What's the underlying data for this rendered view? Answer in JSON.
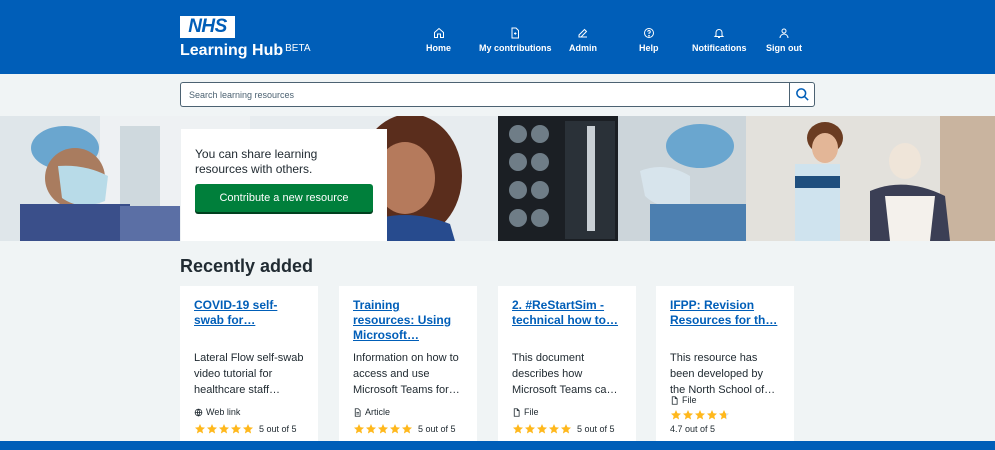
{
  "header": {
    "logo_text": "NHS",
    "app_name": "Learning Hub",
    "app_badge": "BETA",
    "nav": [
      {
        "label": "Home",
        "icon": "home-icon"
      },
      {
        "label": "My contributions",
        "icon": "document-icon"
      },
      {
        "label": "Admin",
        "icon": "edit-icon"
      },
      {
        "label": "Help",
        "icon": "help-icon"
      },
      {
        "label": "Notifications",
        "icon": "bell-icon"
      },
      {
        "label": "Sign out",
        "icon": "user-icon"
      }
    ]
  },
  "search": {
    "placeholder": "Search learning resources"
  },
  "hero": {
    "message": "You can share learning resources with others.",
    "cta_label": "Contribute a new resource"
  },
  "recent": {
    "title": "Recently added",
    "cards": [
      {
        "title": "COVID-19 self-swab for…",
        "description": "Lateral Flow self-swab video tutorial for healthcare staff…",
        "type": "Web link",
        "type_icon": "globe-icon",
        "rating": 5,
        "rating_label": "5 out of 5"
      },
      {
        "title": "Training resources: Using Microsoft…",
        "description": "Information on how to access and use Microsoft Teams for…",
        "type": "Article",
        "type_icon": "article-icon",
        "rating": 5,
        "rating_label": "5 out of 5"
      },
      {
        "title": "2. #ReStartSim - technical how to…",
        "description": "This document describes how Microsoft Teams ca…",
        "type": "File",
        "type_icon": "file-icon",
        "rating": 5,
        "rating_label": "5 out of 5"
      },
      {
        "title": "IFPP: Revision Resources for th…",
        "description": "This resource has been developed by the North School of…",
        "type": "File",
        "type_icon": "file-icon",
        "rating": 4.7,
        "rating_label": "4.7 out of 5"
      }
    ]
  },
  "colors": {
    "brand_blue": "#005eb8",
    "cta_green": "#007f3b",
    "star": "#ffb81c",
    "background": "#f0f4f5"
  }
}
